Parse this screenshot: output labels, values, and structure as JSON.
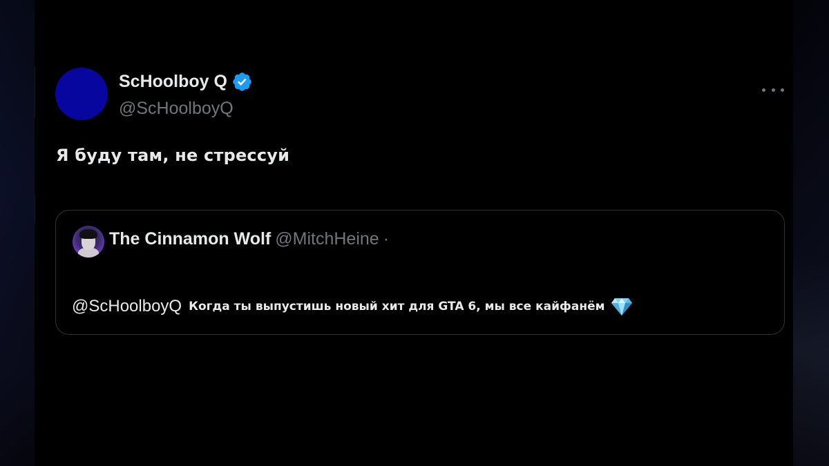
{
  "tweet": {
    "author": {
      "display_name": "ScHoolboy Q",
      "handle": "@ScHoolboyQ",
      "verified": true,
      "avatar_color": "#07069e"
    },
    "text": "Я буду там, не стрессуй",
    "more_icon": "more-horizontal-icon"
  },
  "quoted_tweet": {
    "author": {
      "display_name": "The Cinnamon Wolf",
      "handle": "@MitchHeine",
      "separator": "·"
    },
    "mention": "@ScHoolboyQ",
    "text": "Когда ты выпустишь новый хит для GTA 6, мы все кайфанём",
    "emoji": "gem-stone-icon"
  },
  "colors": {
    "background": "#000000",
    "primary_text": "#e7e9ea",
    "secondary_text": "#71767b",
    "border": "#2f3336",
    "verified_blue": "#1d9bf0"
  }
}
